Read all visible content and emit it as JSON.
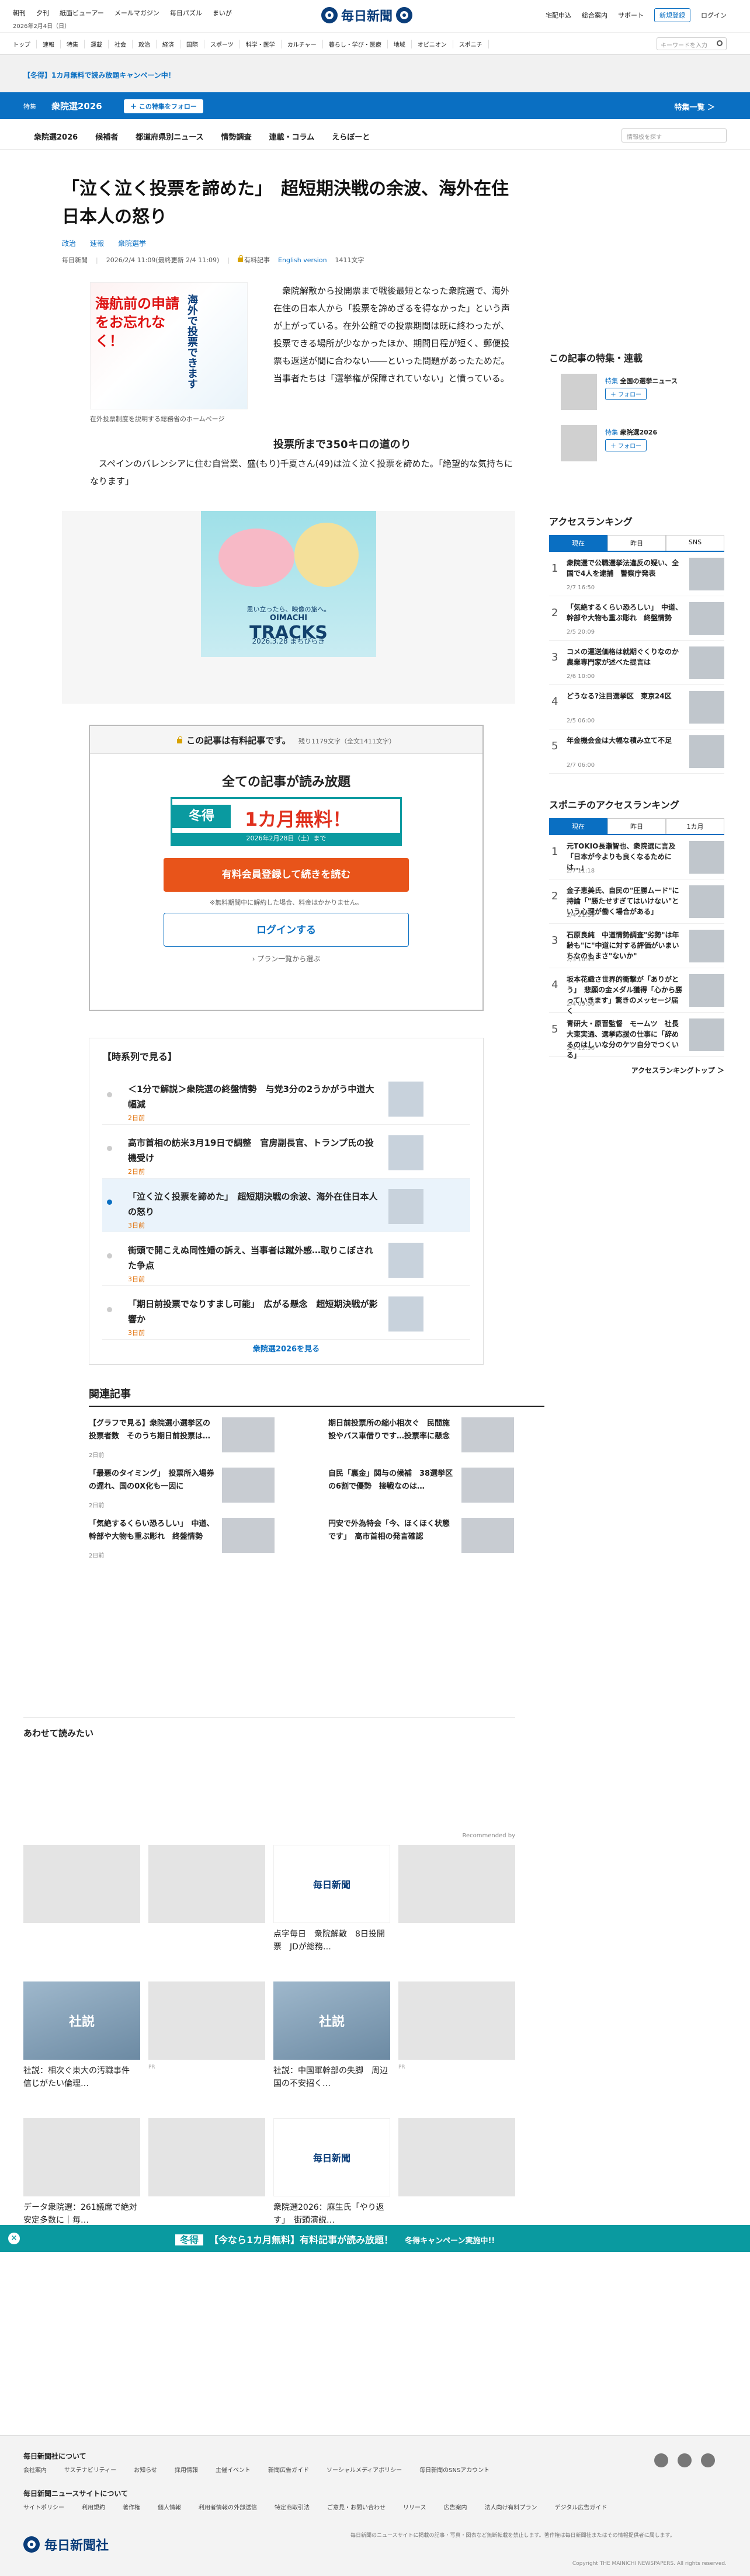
{
  "header": {
    "left_nav": [
      "朝刊",
      "夕刊",
      "紙面ビューアー",
      "メールマガジン",
      "毎日パズル",
      "まいが"
    ],
    "date": "2026年2月4日（日）",
    "logo": "毎日新聞",
    "right_nav": [
      "宅配申込",
      "総合案内",
      "サポート"
    ],
    "register": "新規登録",
    "login": "ログイン"
  },
  "catnav": {
    "items": [
      "トップ",
      "速報",
      "特集",
      "運載",
      "社会",
      "政治",
      "経済",
      "国際",
      "スポーツ",
      "科学・医学",
      "カルチャー",
      "暮らし・学び・医療",
      "地域",
      "オピニオン",
      "スポニチ"
    ],
    "search_placeholder": "キーワードを入力"
  },
  "promo": {
    "text": "【冬得】1カ月無料で読み放題キャンペーン中！"
  },
  "special": {
    "label": "特集",
    "title": "衆院選2026",
    "follow": "＋ この特集をフォロー",
    "list": "特集一覧 ＞"
  },
  "subnav": {
    "items": [
      "衆院選2026",
      "候補者",
      "都道府県別ニュース",
      "情勢調査",
      "連載・コラム",
      "えらぼーと"
    ],
    "search_placeholder": "情報板を探す"
  },
  "article": {
    "title": "「泣く泣く投票を諦めた」　超短期決戦の余波、海外在住日本人の怒り",
    "tags": [
      "政治",
      "速報",
      "衆院選挙"
    ],
    "source": "毎日新聞",
    "datetime": "2026/2/4 11:09(最終更新 2/4 11:09)",
    "paid": "有料記事",
    "english": "English version",
    "chars": "1411文字",
    "image_text1": "海航前の申請をお忘れなく！",
    "image_text2": "海外で投票できます",
    "image_caption": "在外投票制度を説明する総務省のホームページ",
    "lead": "衆院解散から投開票まで戦後最短となった衆院選で、海外在住の日本人から「投票を諦めざるを得なかった」という声が上がっている。在外公館での投票期間は既に終わったが、投票できる場所が少なかったほか、期間日程が短く、郵便投票も返送が間に合わない――といった問題があったためだ。当事者たちは「選挙権が保障されていない」と憤っている。",
    "subhead": "投票所まで350キロの道のり",
    "para2": "スペインのバレンシアに住む自営業、盛(もり)千夏さん(49)は泣く泣く投票を諦めた。「絶望的な気持ちになります」"
  },
  "ad": {
    "tagline": "思い立ったら、映像の旅へ。",
    "brand": "OIMACHI",
    "name": "TRACKS",
    "date": "2026.3.28 まちびらき"
  },
  "paywall": {
    "head": "この記事は有料記事です。",
    "count": "残り1179文字（全文1411文字）",
    "h2": "全ての記事が読み放題",
    "banner_tag": "冬得",
    "banner_main": "1カ月無料！",
    "banner_sub": "2026年2月28日（土）まで",
    "cta": "有料会員登録して続きを読む",
    "note": "※無料期間中に解約した場合、料金はかかりません。",
    "login": "ログインする",
    "plan": "› プラン一覧から選ぶ"
  },
  "timeline": {
    "title": "【時系列で見る】",
    "items": [
      {
        "title": "＜1分で解説＞衆院選の終盤情勢　与党3分の2うかがう中道大幅減",
        "date": "2日前"
      },
      {
        "title": "高市首相の訪米3月19日で調整　官房副長官、トランプ氏の投機受け",
        "date": "2日前"
      },
      {
        "title": "「泣く泣く投票を諦めた」　超短期決戦の余波、海外在住日本人の怒り",
        "date": "3日前"
      },
      {
        "title": "街頭で開こえぬ同性婚の訴え、当事者は蹴外感…取りこぼされた争点",
        "date": "3日前"
      },
      {
        "title": "「期日前投票でなりすまし可能」　広がる懸念　超短期決戦が影響か",
        "date": "3日前"
      }
    ],
    "more": "衆院選2026を見る"
  },
  "related": {
    "title": "関連記事",
    "items": [
      {
        "title": "【グラフで見る】衆院選小選挙区の投票者数　そのうち期日前投票は…",
        "date": "2日前"
      },
      {
        "title": "期日前投票所の縮小相次ぐ　民間施設やバス車借りです…投票率に懸念",
        "date": ""
      },
      {
        "title": "「最悪のタイミング」　投票所入場券の遅れ、国の0X化も一因に",
        "date": "2日前"
      },
      {
        "title": "自民「裏金」関与の候補　38選挙区の6割で優勢　接戦なのは…",
        "date": ""
      },
      {
        "title": "「気絶するくらい恐ろしい」　中道、幹部や大物も重ぶ彫れ　終盤情勢",
        "date": "2日前"
      },
      {
        "title": "円安で外為特会「今、ほくほく状態です」　高市首相の発言確認",
        "date": ""
      }
    ]
  },
  "sidebar": {
    "features_title": "この記事の特集・連載",
    "features": [
      {
        "kind": "特集",
        "name": "全国の選挙ニュース",
        "follow": "＋ フォロー"
      },
      {
        "kind": "特集",
        "name": "衆院選2026",
        "follow": "＋ フォロー"
      }
    ],
    "ranking_title": "アクセスランキング",
    "ranking_tabs": [
      "現在",
      "昨日",
      "SNS"
    ],
    "ranking": [
      {
        "title": "衆院選で公職選挙法違反の疑い、全国で4人を逮捕　警察庁発表",
        "date": "2/7 16:50"
      },
      {
        "title": "「気絶するくらい恐ろしい」　中道、幹部や大物も重ぶ彫れ　終盤情勢",
        "date": "2/5 20:09"
      },
      {
        "title": "コメの運送価格は就期ぐくりなのか　農業専門家が述べた提言は",
        "date": "2/6 10:00"
      },
      {
        "title": "どうなる?注目選挙区　東京24区",
        "date": "2/5 06:00"
      },
      {
        "title": "年金機会金は大幅な積み立て不足",
        "date": "2/7 06:00"
      }
    ],
    "sponichi_title": "スポニチのアクセスランキング",
    "sponichi_tabs": [
      "現在",
      "昨日",
      "1カ月"
    ],
    "sponichi": [
      {
        "title": "元TOKIO長瀬智也、衆院選に言及「日本が今よりも良くなるためには…」",
        "date": "2/7 11:18"
      },
      {
        "title": "金子恵美氏、自民の\"圧勝ムード\"に持論「\"勝たせすぎてはいけない\"という心理が働く場合がある」",
        "date": "2/4 21:59"
      },
      {
        "title": "石原良純　中道情勢調査\"劣勢\"は年齢も\"に\"中道に対する評価がいまいちなのもまさ\"ないか\"",
        "date": "2/3 10:43"
      },
      {
        "title": "坂本花織さ世界的衝撃が「ありがとう」　悲願の金メダル獲得「心から勝っていきます」驚きのメッセージ届く",
        "date": "2/4 09:00"
      },
      {
        "title": "青研大・原晋監督　モームツ　社長大東実通、選挙応援の仕事に「辞めるのはしいな分のケツ自分でつくいる」",
        "date": "2/4 12:50"
      }
    ],
    "ranking_more": "アクセスランキングトップ ＞"
  },
  "recommend": {
    "title": "あわせて読みたい",
    "by": "Recommended by",
    "cards": [
      {
        "title": "",
        "pr": "",
        "tile": "blank"
      },
      {
        "title": "",
        "pr": "",
        "tile": "blank"
      },
      {
        "title": "点字毎日　衆院解散　8日投開票　JDが総務…",
        "pr": "",
        "tile": "logo"
      },
      {
        "title": "",
        "pr": "",
        "tile": "blank"
      },
      {
        "title": "社説：相次ぐ東大の汚職事件　信じがたい倫理…",
        "pr": "",
        "tile": "editorial"
      },
      {
        "title": "",
        "pr": "PR",
        "tile": "blank"
      },
      {
        "title": "社説：中国軍幹部の失脚　周辺国の不安招く…",
        "pr": "",
        "tile": "editorial"
      },
      {
        "title": "",
        "pr": "PR",
        "tile": "blank"
      },
      {
        "title": "データ衆院選：261議席で絶対安定多数に｜毎…",
        "pr": "",
        "tile": "blank"
      },
      {
        "title": "",
        "pr": "",
        "tile": "blank"
      },
      {
        "title": "衆院選2026：麻生氏「やり返す」　街頭演説…",
        "pr": "",
        "tile": "logo"
      },
      {
        "title": "",
        "pr": "",
        "tile": "blank"
      }
    ]
  },
  "floatbar": {
    "tag": "冬得",
    "text": "【今なら1カ月無料】有料記事が読み放題！",
    "sub": "冬得キャンペーン実施中!!"
  },
  "footer": {
    "about": "毎日新聞社について",
    "links1": [
      "会社案内",
      "サステナビリティー",
      "お知らせ",
      "採用情報",
      "主催イベント",
      "新聞広告ガイド",
      "ソーシャルメディアポリシー",
      "毎日新聞のSNSアカウント"
    ],
    "site": "毎日新聞ニュースサイトについて",
    "links2": [
      "サイトポリシー",
      "利用規約",
      "著作権",
      "個人情報",
      "利用者情報の外部送信",
      "特定商取引法",
      "ご意見・お問い合わせ",
      "リリース",
      "広告案内",
      "法人向け有料プラン",
      "デジタル広告ガイド"
    ],
    "note": "毎日新聞のニュースサイトに掲載の記事・写真・図表など無断転載を禁止します。著作権は毎日新聞社またはその情報提供者に属します。",
    "copy": "Copyright THE MAINICHI NEWSPAPERS. All rights reserved.",
    "logo": "毎日新聞社"
  }
}
